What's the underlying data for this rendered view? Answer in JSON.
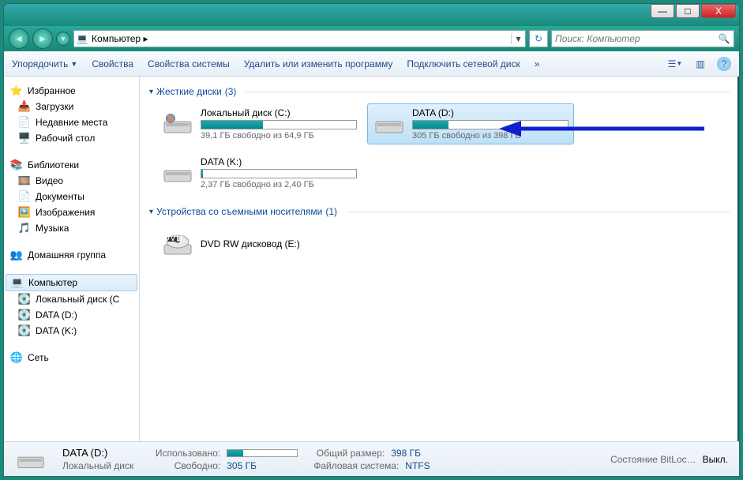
{
  "window": {
    "min": "—",
    "max": "□",
    "close": "X"
  },
  "address": {
    "path": "Компьютер ▸"
  },
  "search": {
    "placeholder": "Поиск: Компьютер"
  },
  "toolbar": {
    "organize": "Упорядочить",
    "properties": "Свойства",
    "sysprops": "Свойства системы",
    "uninstall": "Удалить или изменить программу",
    "mapdrive": "Подключить сетевой диск",
    "more": "»"
  },
  "sidebar": {
    "favorites": "Избранное",
    "downloads": "Загрузки",
    "recent": "Недавние места",
    "desktop": "Рабочий стол",
    "libraries": "Библиотеки",
    "videos": "Видео",
    "documents": "Документы",
    "pictures": "Изображения",
    "music": "Музыка",
    "homegroup": "Домашняя группа",
    "computer": "Компьютер",
    "localc": "Локальный диск (C",
    "datad": "DATA (D:)",
    "datak": "DATA (K:)",
    "network": "Сеть"
  },
  "groups": {
    "hdd": {
      "label": "Жесткие диски",
      "count": "(3)"
    },
    "removable": {
      "label": "Устройства со съемными носителями",
      "count": "(1)"
    }
  },
  "drives": {
    "c": {
      "name": "Локальный диск (C:)",
      "sub": "39,1 ГБ свободно из 64,9 ГБ",
      "pct": 40
    },
    "d": {
      "name": "DATA (D:)",
      "sub": "305 ГБ свободно из 398 ГБ",
      "pct": 23
    },
    "k": {
      "name": "DATA (K:)",
      "sub": "2,37 ГБ свободно из 2,40 ГБ",
      "pct": 1
    },
    "e": {
      "name": "DVD RW дисковод (E:)"
    }
  },
  "status": {
    "name": "DATA (D:)",
    "type": "Локальный диск",
    "used_lbl": "Использовано:",
    "free_lbl": "Свободно:",
    "free_val": "305 ГБ",
    "size_lbl": "Общий размер:",
    "size_val": "398 ГБ",
    "fs_lbl": "Файловая система:",
    "fs_val": "NTFS",
    "bitlocker_lbl": "Состояние BitLoc…",
    "bitlocker_val": "Выкл."
  }
}
